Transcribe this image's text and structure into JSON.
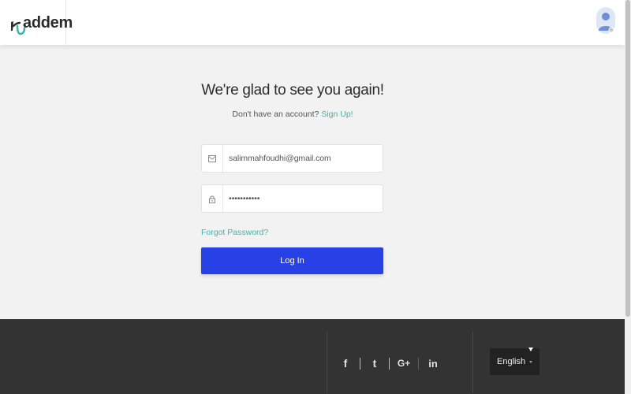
{
  "header": {
    "logo_text": "addem",
    "avatar_icon": "user-avatar-icon"
  },
  "login": {
    "title": "We're glad to see you again!",
    "subtitle_prefix": "Don't have an account?",
    "signup_link": "Sign Up!",
    "email_value": "salimmahfoudhi@gmail.com",
    "email_icon": "envelope-icon",
    "password_value": "•••••••••••",
    "password_icon": "lock-icon",
    "forgot_link": "Forgot Password?",
    "login_button": "Log In"
  },
  "footer": {
    "social": [
      {
        "name": "facebook-icon",
        "glyph": "f"
      },
      {
        "name": "twitter-icon",
        "glyph": "t"
      },
      {
        "name": "google-plus-icon",
        "glyph": "G+"
      },
      {
        "name": "linkedin-icon",
        "glyph": "in"
      }
    ],
    "language": "English"
  },
  "colors": {
    "accent": "#3bb6b0",
    "primary_button": "#2741e6",
    "footer_bg": "#333333",
    "page_bg": "#f2f2f2"
  }
}
